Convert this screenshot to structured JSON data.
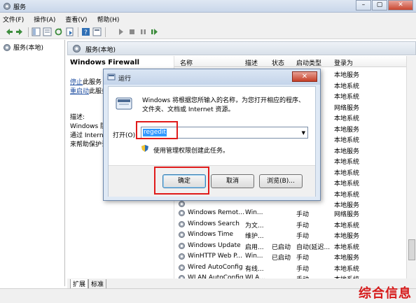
{
  "window": {
    "title": "服务"
  },
  "menu": [
    "文件(F)",
    "操作(A)",
    "查看(V)",
    "帮助(H)"
  ],
  "tree": {
    "root_label": "服务(本地)"
  },
  "content_header": "服务(本地)",
  "desc": {
    "service_name": "Windows Firewall",
    "stop_link": "停止",
    "stop_suffix": "此服务",
    "restart_link": "重启动",
    "restart_suffix": "此服务",
    "desc_label": "描述:",
    "desc_line1": "Windows 防",
    "desc_line2": "通过 Interne",
    "desc_line3": "来帮助保护计"
  },
  "list": {
    "columns": [
      "名称",
      "描述",
      "状态",
      "启动类型",
      "登录为"
    ],
    "top_rows": [
      {
        "startup": "",
        "logon": "本地服务"
      },
      {
        "startup": "",
        "logon": "本地系统"
      },
      {
        "startup": "",
        "logon": "本地系统"
      },
      {
        "startup": "",
        "logon": "网络服务"
      },
      {
        "startup": "",
        "logon": "本地系统"
      },
      {
        "startup": "",
        "logon": "本地服务"
      },
      {
        "startup": "",
        "logon": "本地系统"
      },
      {
        "startup": "",
        "logon": "本地服务"
      },
      {
        "startup": "",
        "logon": "本地系统"
      },
      {
        "startup": "",
        "logon": "本地系统"
      },
      {
        "startup": "",
        "logon": "本地系统"
      },
      {
        "startup": "",
        "logon": "本地系统"
      },
      {
        "startup": "",
        "logon": "本地服务"
      }
    ],
    "rows": [
      {
        "name": "Windows Remot...",
        "desc": "Win...",
        "status": "",
        "startup": "手动",
        "logon": "网络服务"
      },
      {
        "name": "Windows Search",
        "desc": "为文...",
        "status": "",
        "startup": "手动",
        "logon": "本地系统"
      },
      {
        "name": "Windows Time",
        "desc": "维护...",
        "status": "",
        "startup": "手动",
        "logon": "本地服务"
      },
      {
        "name": "Windows Update",
        "desc": "启用...",
        "status": "已启动",
        "startup": "自动(延迟...",
        "logon": "本地系统"
      },
      {
        "name": "WinHTTP Web P...",
        "desc": "Win...",
        "status": "已启动",
        "startup": "手动",
        "logon": "本地服务"
      },
      {
        "name": "Wired AutoConfig",
        "desc": "有线...",
        "status": "",
        "startup": "手动",
        "logon": "本地系统"
      },
      {
        "name": "WLAN AutoConfig",
        "desc": "WLA...",
        "status": "",
        "startup": "手动",
        "logon": "本地系统"
      }
    ]
  },
  "tabs": [
    "扩展",
    "标准"
  ],
  "dialog": {
    "title": "运行",
    "description": "Windows 将根据您所输入的名称，为您打开相应的程序、文件夹、文档或 Internet 资源。",
    "open_label": "打开(O):",
    "input_value": "regedit",
    "admin_note": "使用管理权限创建此任务。",
    "ok_label": "确定",
    "cancel_label": "取消",
    "browse_label": "浏览(B)...",
    "close_label": "✕"
  },
  "watermark": "综合信息",
  "colors": {
    "highlight": "#e01b1b",
    "selection": "#3399ff",
    "link": "#1f4ea1"
  }
}
